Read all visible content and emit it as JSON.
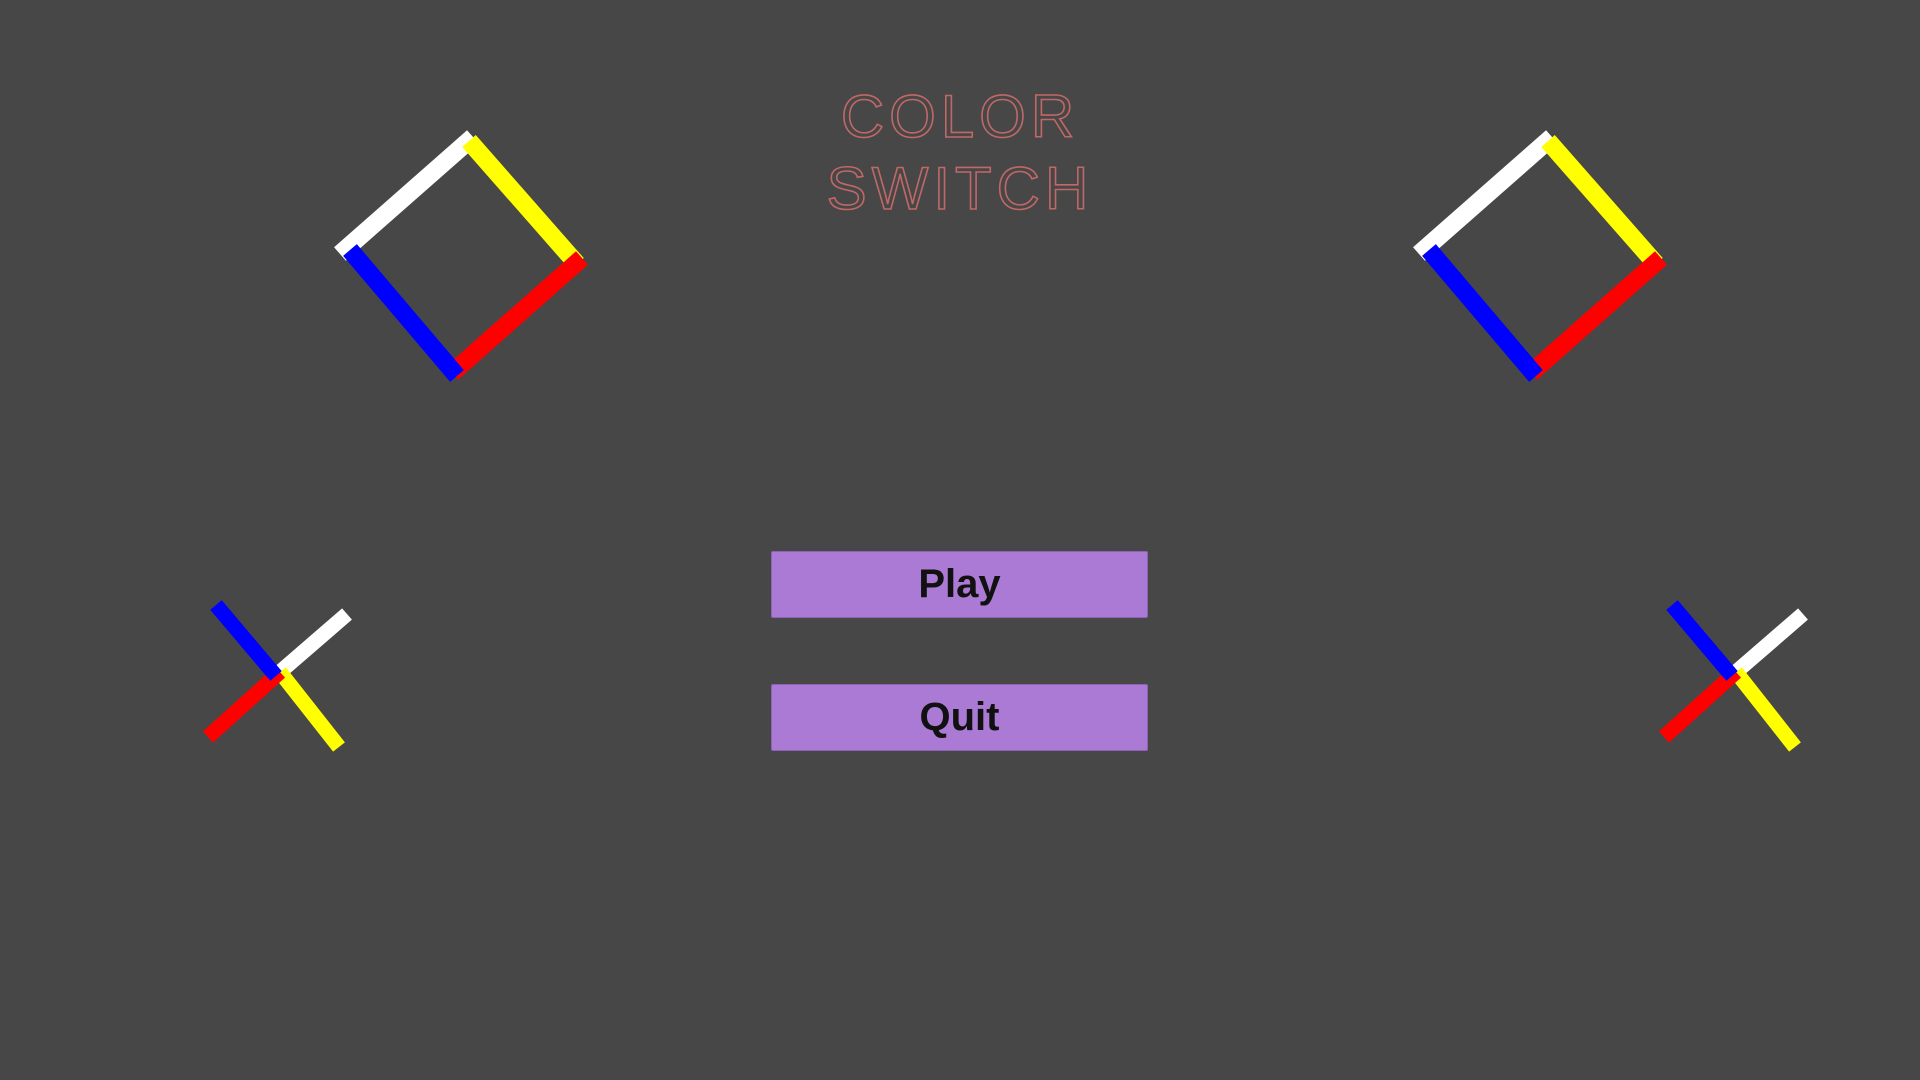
{
  "title": {
    "line1": "COLOR",
    "line2": "SWITCH",
    "color": "#c06868"
  },
  "menu": {
    "play_label": "Play",
    "quit_label": "Quit",
    "button_color": "#ab7ad4"
  },
  "background_color": "#474747",
  "obstacle_colors": {
    "white": "#ffffff",
    "yellow": "#ffff00",
    "red": "#ff0000",
    "blue": "#0000ff"
  },
  "decorations": [
    "square-obstacle-left",
    "square-obstacle-right",
    "cross-obstacle-left",
    "cross-obstacle-right"
  ]
}
